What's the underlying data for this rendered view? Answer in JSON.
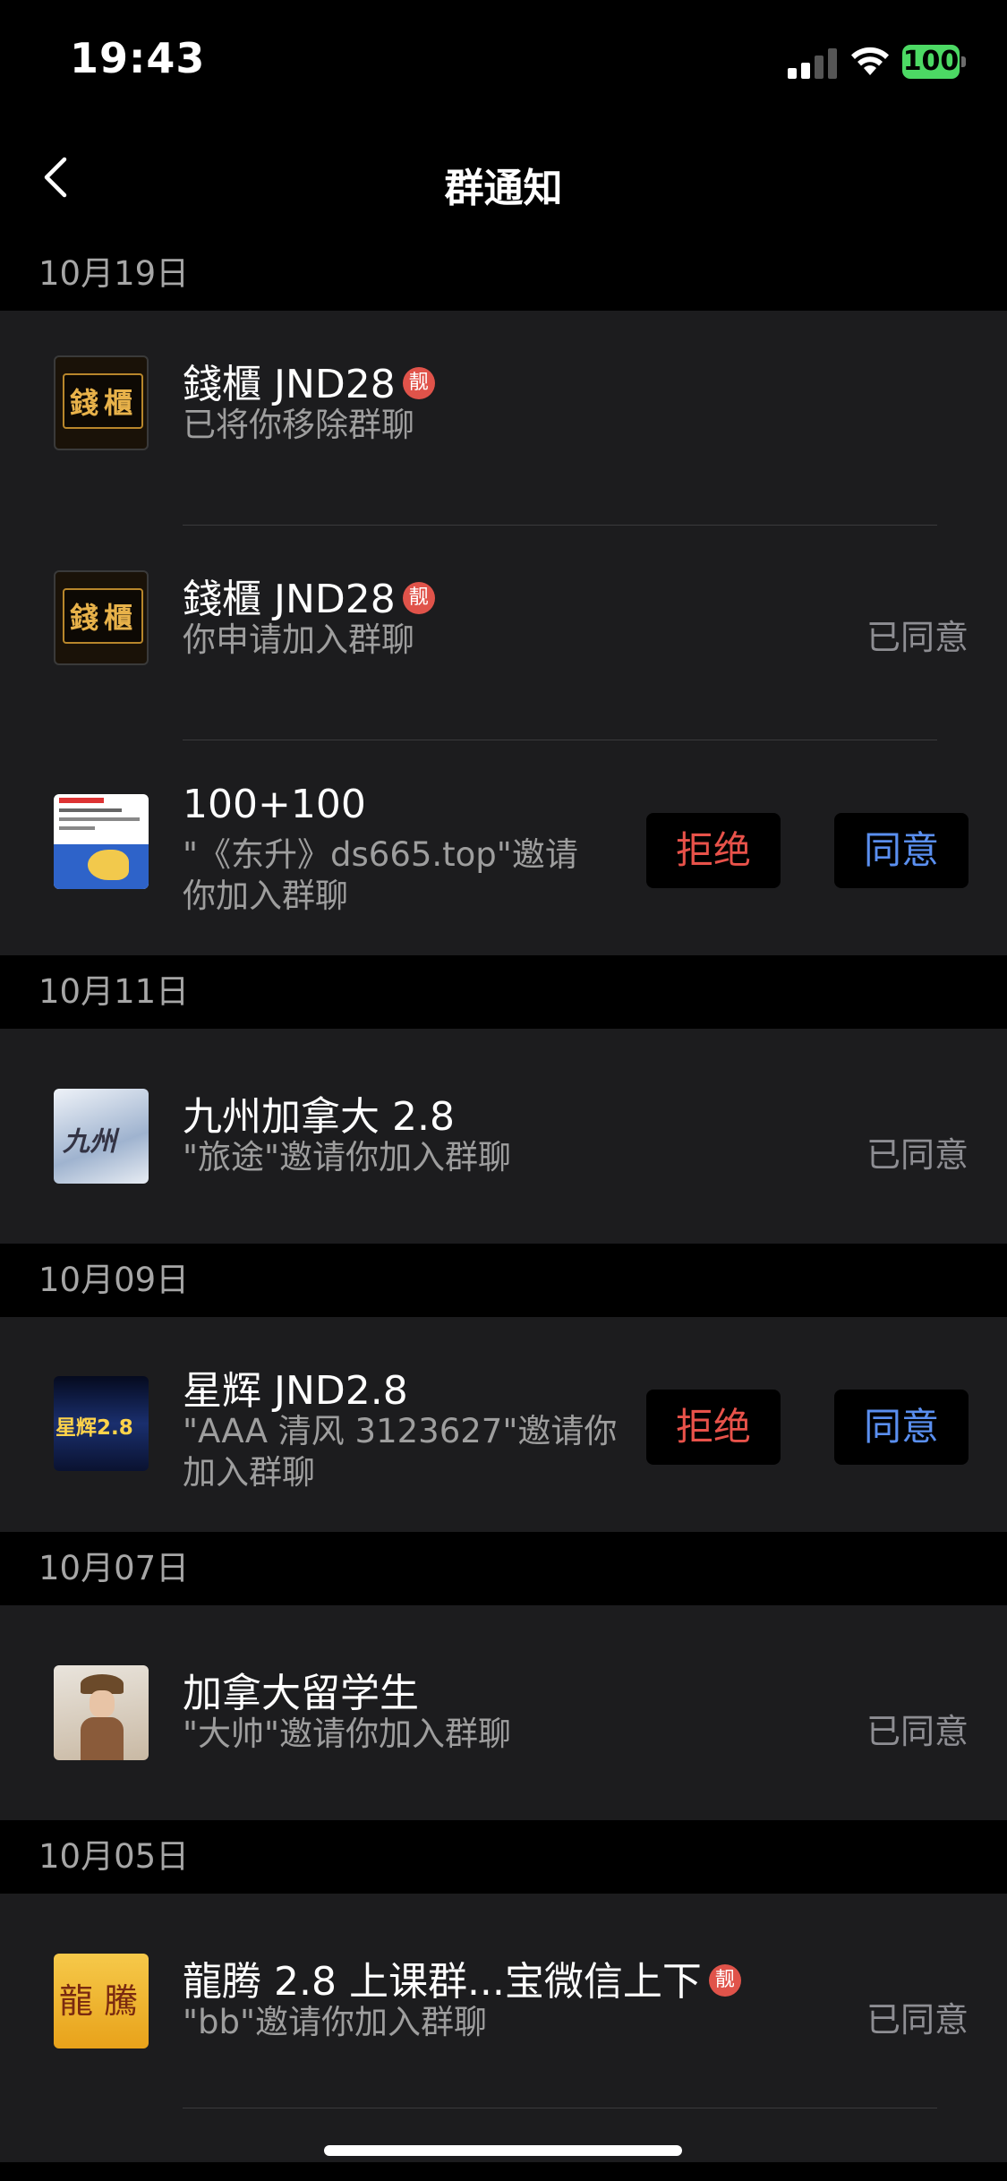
{
  "status_bar": {
    "time": "19:43",
    "battery": "100"
  },
  "nav": {
    "title": "群通知"
  },
  "colors": {
    "accent_reject": "#e8524a",
    "accent_accept": "#5a8ff0",
    "battery": "#4cd964"
  },
  "groups": [
    {
      "date": "10月19日",
      "items": [
        {
          "name": "錢櫃 JND28",
          "badge": "靓",
          "desc": "已将你移除群聊",
          "status": ""
        },
        {
          "name": "錢櫃 JND28",
          "badge": "靓",
          "desc": "你申请加入群聊",
          "status": "已同意"
        },
        {
          "name": "100+100",
          "desc_line1": "\"《东升》ds665.top\"邀请",
          "desc_line2": "你加入群聊",
          "reject": "拒绝",
          "accept": "同意"
        }
      ]
    },
    {
      "date": "10月11日",
      "items": [
        {
          "name": "九州加拿大 2.8",
          "desc": "\"旅途\"邀请你加入群聊",
          "status": "已同意"
        }
      ]
    },
    {
      "date": "10月09日",
      "items": [
        {
          "name": "星辉 JND2.8",
          "desc_line1": "\"AAA 清风 3123627\"邀请你",
          "desc_line2": "加入群聊",
          "reject": "拒绝",
          "accept": "同意"
        }
      ]
    },
    {
      "date": "10月07日",
      "items": [
        {
          "name": "加拿大留学生",
          "desc": "\"大帅\"邀请你加入群聊",
          "status": "已同意"
        }
      ]
    },
    {
      "date": "10月05日",
      "items": [
        {
          "name": "龍腾 2.8 上课群...宝微信上下",
          "badge": "靓",
          "desc": "\"bb\"邀请你加入群聊",
          "status": "已同意"
        }
      ]
    }
  ],
  "avatars": {
    "qiangui_top": "錢",
    "qiangui_bot": "櫃",
    "longteng_left": "龍",
    "longteng_right": "騰",
    "xinghui": "星辉2.8",
    "jiuzhou": "九州"
  }
}
